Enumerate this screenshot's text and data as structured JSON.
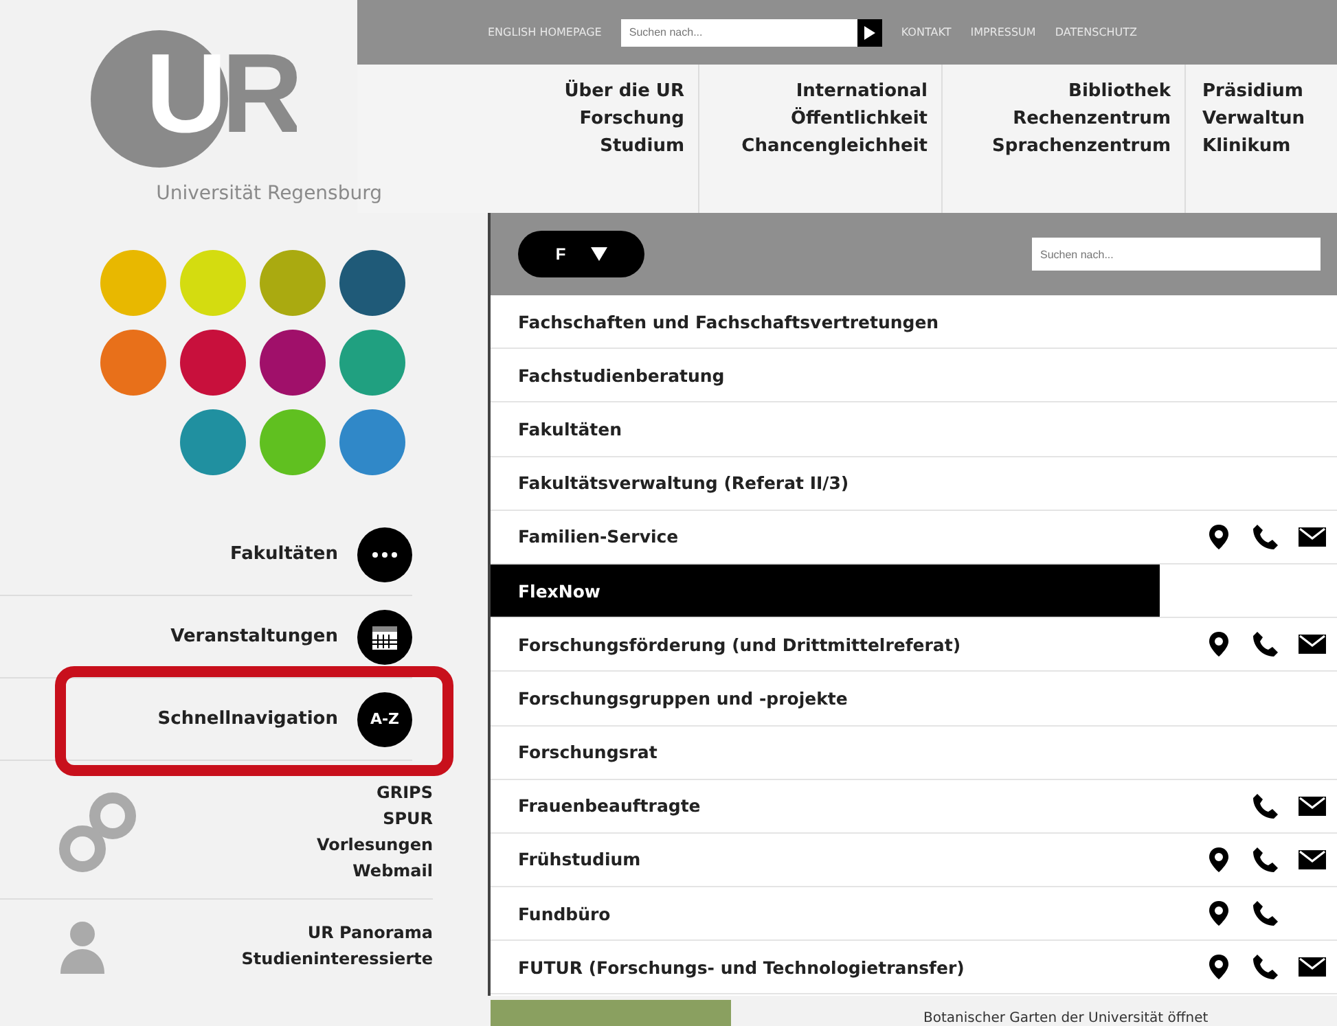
{
  "logo": {
    "letters": "UR",
    "name": "Universität Regensburg"
  },
  "top_bar": {
    "links": [
      "ENGLISH HOMEPAGE"
    ],
    "search": {
      "placeholder": "Suchen nach..."
    },
    "right_links": [
      "KONTAKT",
      "IMPRESSUM",
      "DATENSCHUTZ"
    ]
  },
  "main_nav": [
    [
      "Über die UR",
      "Forschung",
      "Studium"
    ],
    [
      "International",
      "Öffentlichkeit",
      "Chancengleichheit"
    ],
    [
      "Bibliothek",
      "Rechenzentrum",
      "Sprachenzentrum"
    ],
    [
      "Präsidium",
      "Verwaltun",
      "Klinikum"
    ]
  ],
  "color_dot_rows": [
    [
      {
        "color": "#e8b800"
      },
      {
        "color": "#d4dc10"
      },
      {
        "color": "#aaaa10"
      },
      {
        "color": "#1f5a78"
      }
    ],
    [
      {
        "color": "#e8701a"
      },
      {
        "color": "#c8103c"
      },
      {
        "color": "#a0106a"
      },
      {
        "color": "#20a080"
      }
    ],
    [
      {
        "color": "#2090a0"
      },
      {
        "color": "#60c020"
      },
      {
        "color": "#3088c8"
      }
    ]
  ],
  "side_menu": [
    {
      "label": "Fakultäten",
      "kind": "dots",
      "highlighted": false
    },
    {
      "label": "Veranstaltungen",
      "kind": "calendar",
      "highlighted": false
    },
    {
      "label": "Schnellnavigation",
      "kind": "az",
      "badge": "A-Z",
      "highlighted": true
    }
  ],
  "quick_links": [
    "GRIPS",
    "SPUR",
    "Vorlesungen",
    "Webmail"
  ],
  "audience_links": [
    "UR Panorama",
    "Studieninteressierte"
  ],
  "az_panel": {
    "letter": "F",
    "search": {
      "placeholder": "Suchen nach..."
    },
    "rows": [
      {
        "label": "Fachschaften und Fachschaftsvertretungen",
        "selected": false,
        "location": false,
        "phone": false,
        "mail": false
      },
      {
        "label": "Fachstudienberatung",
        "selected": false,
        "location": false,
        "phone": false,
        "mail": false
      },
      {
        "label": "Fakultäten",
        "selected": false,
        "location": false,
        "phone": false,
        "mail": false
      },
      {
        "label": "Fakultätsverwaltung (Referat II/3)",
        "selected": false,
        "location": false,
        "phone": false,
        "mail": false
      },
      {
        "label": "Familien-Service",
        "selected": false,
        "location": true,
        "phone": true,
        "mail": true
      },
      {
        "label": "FlexNow",
        "selected": true,
        "location": false,
        "phone": false,
        "mail": false
      },
      {
        "label": "Forschungsförderung (und Drittmittelreferat)",
        "selected": false,
        "location": true,
        "phone": true,
        "mail": true
      },
      {
        "label": "Forschungsgruppen und -projekte",
        "selected": false,
        "location": false,
        "phone": false,
        "mail": false
      },
      {
        "label": "Forschungsrat",
        "selected": false,
        "location": false,
        "phone": false,
        "mail": false
      },
      {
        "label": "Frauenbeauftragte",
        "selected": false,
        "location": false,
        "phone": true,
        "mail": true
      },
      {
        "label": "Frühstudium",
        "selected": false,
        "location": true,
        "phone": true,
        "mail": true
      },
      {
        "label": "Fundbüro",
        "selected": false,
        "location": true,
        "phone": true,
        "mail": false
      },
      {
        "label": "FUTUR (Forschungs- und Technologietransfer)",
        "selected": false,
        "location": true,
        "phone": true,
        "mail": true
      }
    ]
  },
  "news_caption": "Botanischer Garten der Universität öffnet"
}
